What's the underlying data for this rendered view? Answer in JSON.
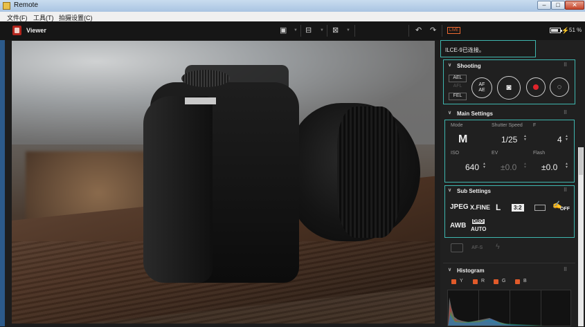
{
  "window": {
    "title": "Remote"
  },
  "menu": [
    "文件(F)",
    "工具(T)",
    "拍摄设置(C)"
  ],
  "toolbar": {
    "viewer_label": "Viewer",
    "live_badge": "LIVE",
    "battery_percent": "51 %",
    "icons": [
      "layout-single-icon",
      "layout-split-icon",
      "layout-grid-icon",
      "rotate-left-icon",
      "rotate-right-icon",
      "battery-icon",
      "plug-icon"
    ]
  },
  "connection_status": "ILCE-9已连接。",
  "shooting": {
    "title": "Shooting",
    "buttons": [
      "AEL",
      "AFL",
      "FEL"
    ],
    "af_ae": "AF\nAE",
    "icons": [
      "camera-shutter-icon",
      "record-icon",
      "self-timer-icon"
    ]
  },
  "main_settings": {
    "title": "Main Settings",
    "mode": {
      "label": "Mode",
      "value": "M"
    },
    "shutter": {
      "label": "Shutter Speed",
      "value": "1/25"
    },
    "fnumber": {
      "label": "F",
      "value": "4"
    },
    "iso": {
      "label": "ISO",
      "value": "640"
    },
    "ev": {
      "label": "EV",
      "value": "±0.0"
    },
    "flash": {
      "label": "Flash",
      "value": "±0.0"
    }
  },
  "sub_settings": {
    "title": "Sub Settings",
    "row1": [
      "JPEG",
      "X.FINE",
      "L",
      "3:2"
    ],
    "steady_off": "OFF",
    "row2_awb": "AWB",
    "row2_dro": "DRO",
    "row2_auto": "AUTO",
    "dimmed": [
      "AF-S"
    ]
  },
  "histogram": {
    "title": "Histogram",
    "channels": [
      "Y",
      "R",
      "G",
      "B"
    ]
  },
  "colors": {
    "accent": "#3fb8b0",
    "live": "#f06a30",
    "record": "#e0242b"
  }
}
